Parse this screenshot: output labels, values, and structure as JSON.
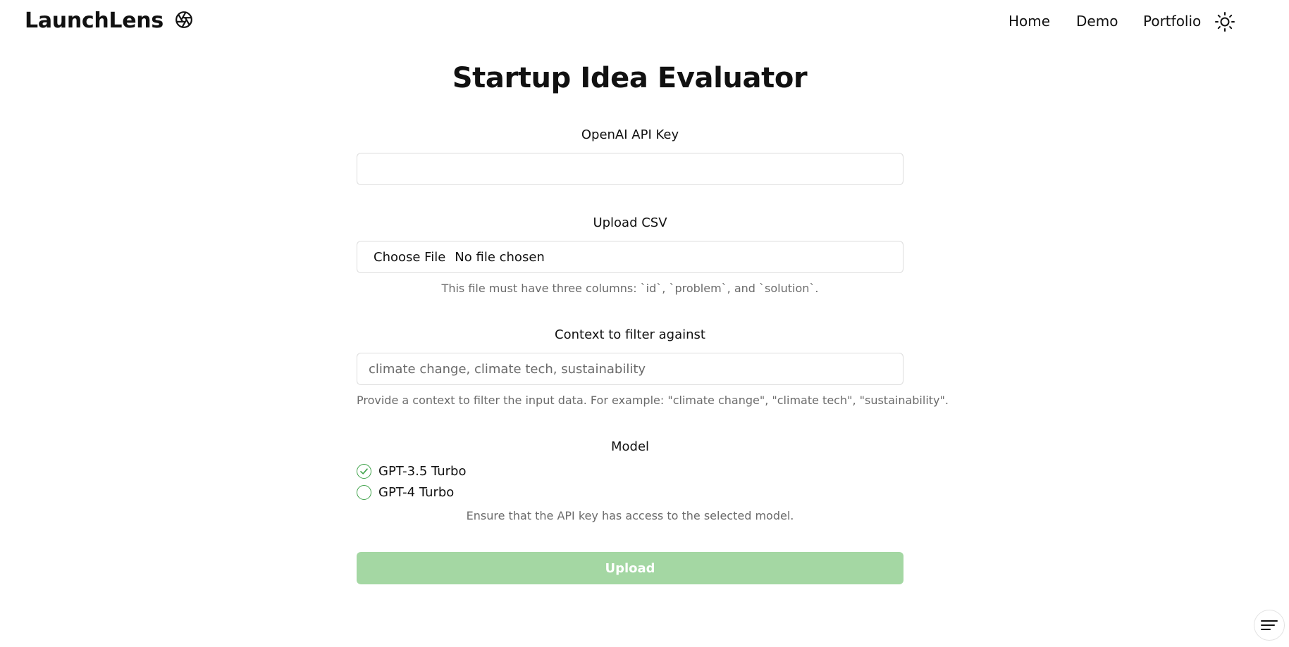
{
  "nav": {
    "brand": "LaunchLens",
    "brand_icon": "aperture-icon",
    "links": [
      {
        "label": "Home"
      },
      {
        "label": "Demo"
      },
      {
        "label": "Portfolio"
      }
    ],
    "theme_toggle_icon": "sun-icon"
  },
  "page": {
    "title": "Startup Idea Evaluator"
  },
  "form": {
    "api_key": {
      "label": "OpenAI API Key",
      "value": "",
      "placeholder": ""
    },
    "upload_csv": {
      "label": "Upload CSV",
      "button_label": "Choose File",
      "status": "No file chosen",
      "hint": "This file must have three columns: `id`, `problem`, and `solution`."
    },
    "context": {
      "label": "Context to filter against",
      "value": "",
      "placeholder": "climate change, climate tech, sustainability",
      "hint": "Provide a context to filter the input data. For example: \"climate change\", \"climate tech\", \"sustainability\"."
    },
    "model": {
      "label": "Model",
      "options": [
        {
          "label": "GPT-3.5 Turbo",
          "selected": true
        },
        {
          "label": "GPT-4 Turbo",
          "selected": false
        }
      ],
      "hint": "Ensure that the API key has access to the selected model."
    },
    "submit_label": "Upload"
  },
  "colors": {
    "accent_green": "#3fa24a",
    "button_disabled_green": "#a4d7a3",
    "muted_text": "#6b6b6b",
    "border": "#dddddd"
  },
  "fab_icon": "menu-lines-icon"
}
